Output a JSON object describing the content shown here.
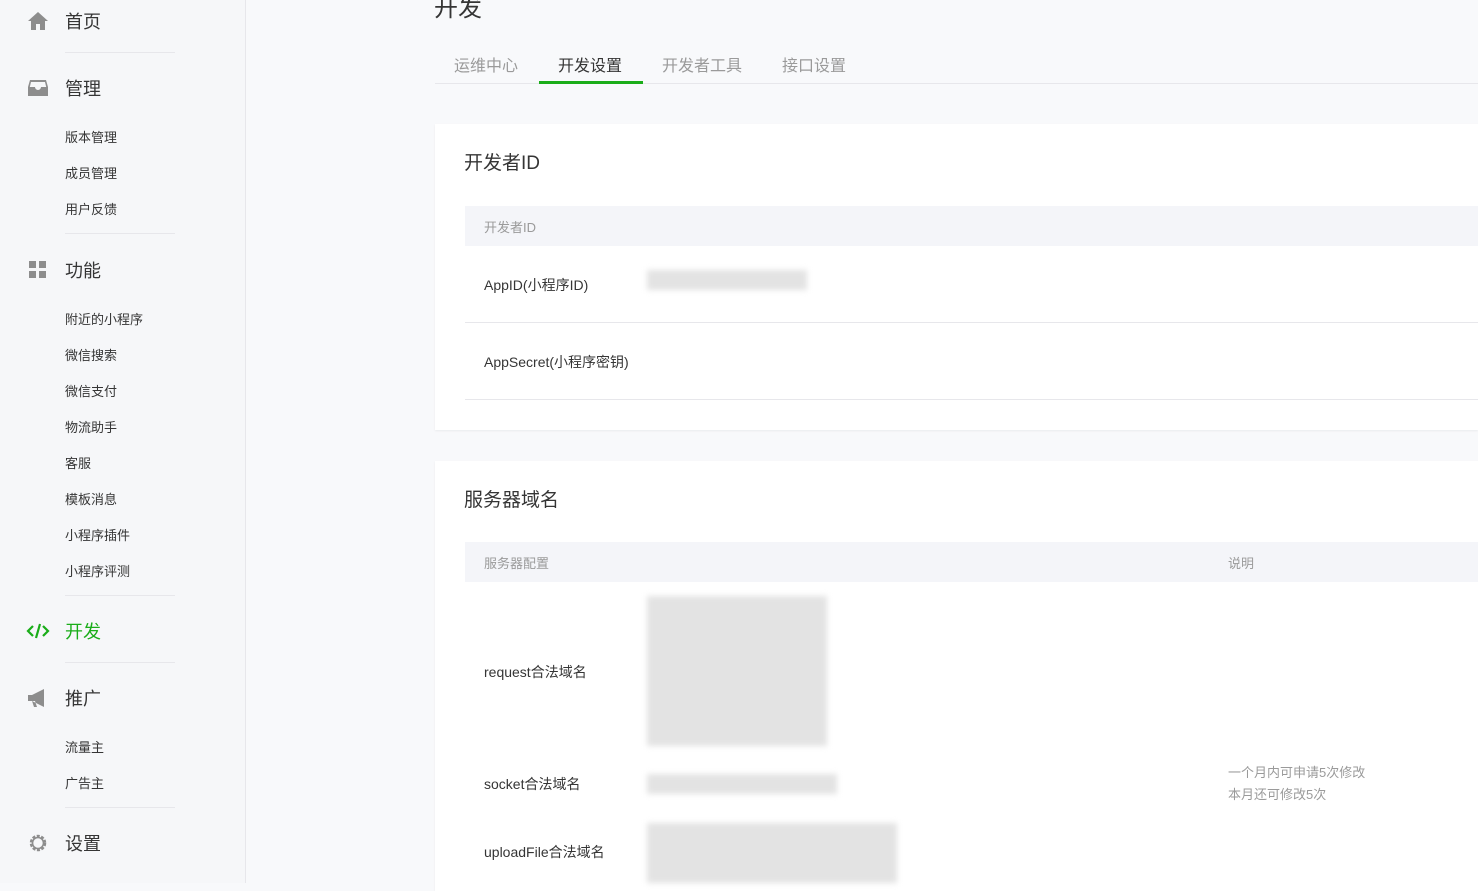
{
  "sidebar": {
    "home": "首页",
    "manage": {
      "label": "管理",
      "items": [
        "版本管理",
        "成员管理",
        "用户反馈"
      ]
    },
    "features": {
      "label": "功能",
      "items": [
        "附近的小程序",
        "微信搜索",
        "微信支付",
        "物流助手",
        "客服",
        "模板消息",
        "小程序插件",
        "小程序评测"
      ]
    },
    "develop": "开发",
    "promote": {
      "label": "推广",
      "items": [
        "流量主",
        "广告主"
      ]
    },
    "settings": "设置"
  },
  "page_title": "开发",
  "tabs": [
    "运维中心",
    "开发设置",
    "开发者工具",
    "接口设置"
  ],
  "active_tab": "开发设置",
  "developer_id": {
    "title": "开发者ID",
    "header": "开发者ID",
    "rows": [
      "AppID(小程序ID)",
      "AppSecret(小程序密钥)"
    ]
  },
  "server_domain": {
    "title": "服务器域名",
    "headers": [
      "服务器配置",
      "说明"
    ],
    "rows": [
      "request合法域名",
      "socket合法域名",
      "uploadFile合法域名"
    ],
    "note": [
      "一个月内可申请5次修改",
      "本月还可修改5次"
    ]
  },
  "colors": {
    "accent": "#1aad19"
  }
}
